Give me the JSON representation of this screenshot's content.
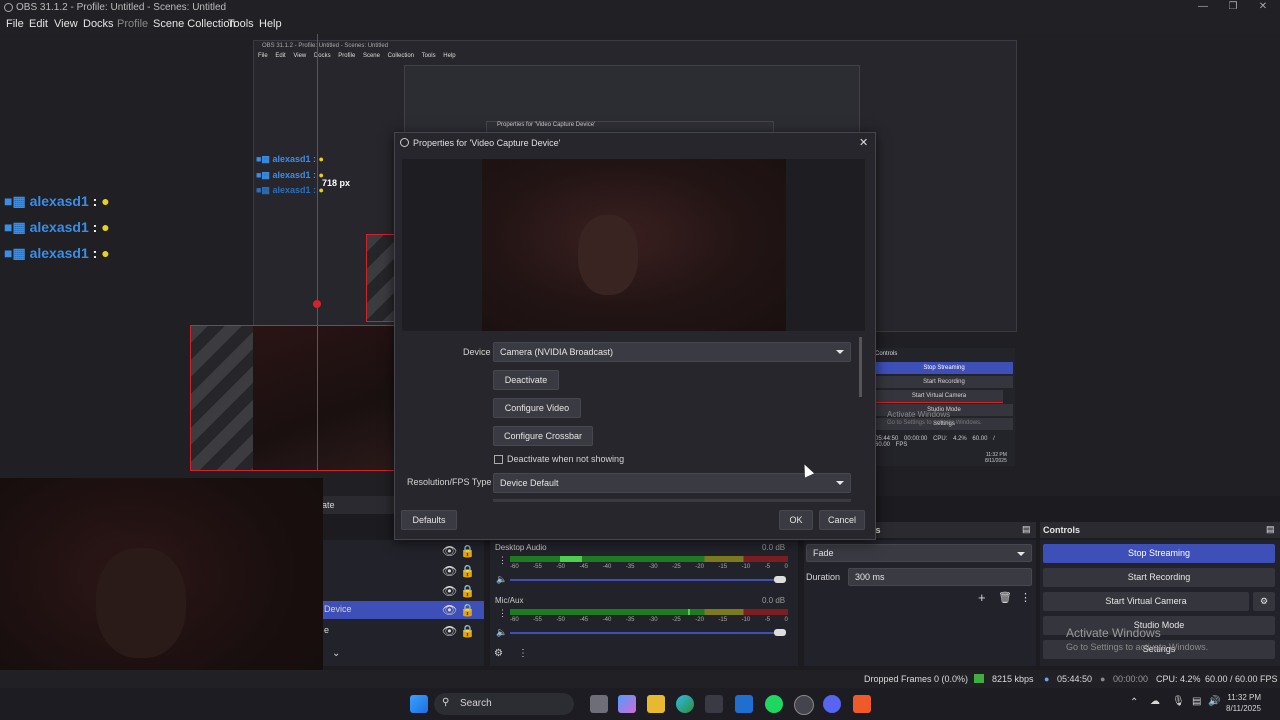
{
  "window": {
    "title": "OBS 31.1.2 - Profile: Untitled - Scenes: Untitled"
  },
  "menu": [
    "File",
    "Edit",
    "View",
    "Docks",
    "Profile",
    "Scene Collection",
    "Tools",
    "Help"
  ],
  "nested": {
    "title": "OBS 31.1.2 - Profile: Untitled - Scenes: Untitled",
    "menu": [
      "File",
      "Edit",
      "View",
      "Docks",
      "Profile",
      "Scene Collection",
      "Tools",
      "Help"
    ],
    "dialog_title": "Properties for 'Video Capture Device'",
    "controls_title": "Controls",
    "controls": [
      "Stop Streaming",
      "Start Recording",
      "Start Virtual Camera",
      "Studio Mode",
      "Settings"
    ],
    "activate": "Activate Windows",
    "activate_sub": "Go to Settings to activate Windows.",
    "status": [
      "05:44:50",
      "00:00:00",
      "CPU: 4.2%",
      "60.00 / 60.00 FPS"
    ],
    "clock_time": "11:32 PM",
    "clock_date": "8/11/2025"
  },
  "chat": {
    "user": "alexasd1",
    "sep": ":",
    "measure": "718 px"
  },
  "dialog": {
    "title": "Properties for 'Video Capture Device'",
    "device_label": "Device",
    "device_value": "Camera (NVIDIA Broadcast)",
    "deactivate": "Deactivate",
    "configure_video": "Configure Video",
    "configure_crossbar": "Configure Crossbar",
    "deactivate_when_hidden": "Deactivate when not showing",
    "resfps_label": "Resolution/FPS Type",
    "resfps_value": "Device Default",
    "defaults": "Defaults",
    "ok": "OK",
    "cancel": "Cancel"
  },
  "sources": {
    "partial_tab": "ate",
    "item_device": "Device",
    "item_e": "e"
  },
  "mixer": {
    "desktop_label": "Desktop Audio",
    "desktop_db": "0.0 dB",
    "mic_label": "Mic/Aux",
    "mic_db": "0.0 dB",
    "scale": [
      "-60",
      "-55",
      "-50",
      "-45",
      "-40",
      "-35",
      "-30",
      "-25",
      "-20",
      "-15",
      "-10",
      "-5",
      "0"
    ]
  },
  "transitions": {
    "header": "ns",
    "fade": "Fade",
    "duration_label": "Duration",
    "duration_value": "300 ms"
  },
  "controls": {
    "header": "Controls",
    "stop_streaming": "Stop Streaming",
    "start_recording": "Start Recording",
    "start_virtual_camera": "Start Virtual Camera",
    "studio_mode": "Studio Mode",
    "settings": "Settings",
    "activate": "Activate Windows",
    "activate_sub": "Go to Settings to activate Windows."
  },
  "status": {
    "dropped": "Dropped Frames 0 (0.0%)",
    "kbps": "8215 kbps",
    "stream_time": "05:44:50",
    "rec_time": "00:00:00",
    "cpu": "CPU: 4.2%",
    "fps": "60.00 / 60.00 FPS"
  },
  "taskbar": {
    "search": "Search",
    "time": "11:32 PM",
    "date": "8/11/2025"
  },
  "colors": {
    "accent_blue": "#3e4fb8",
    "red_guide": "#d4222b",
    "chat_blue": "#3a8ee8"
  }
}
